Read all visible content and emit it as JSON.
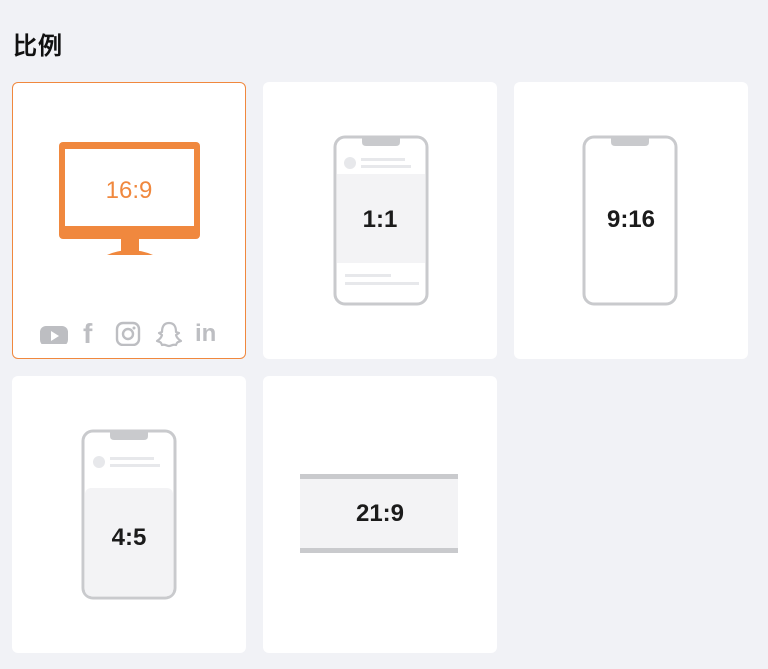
{
  "section": {
    "title": "比例"
  },
  "ratios": [
    {
      "label": "16:9",
      "selected": true
    },
    {
      "label": "1:1",
      "selected": false
    },
    {
      "label": "9:16",
      "selected": false
    },
    {
      "label": "4:5",
      "selected": false
    },
    {
      "label": "21:9",
      "selected": false
    }
  ],
  "social_icons": [
    "youtube-icon",
    "facebook-icon",
    "instagram-icon",
    "snapchat-icon",
    "linkedin-icon"
  ],
  "colors": {
    "accent": "#f0883e",
    "frame": "#c9cacd",
    "screen": "#f3f3f5",
    "background": "#f1f2f6"
  }
}
